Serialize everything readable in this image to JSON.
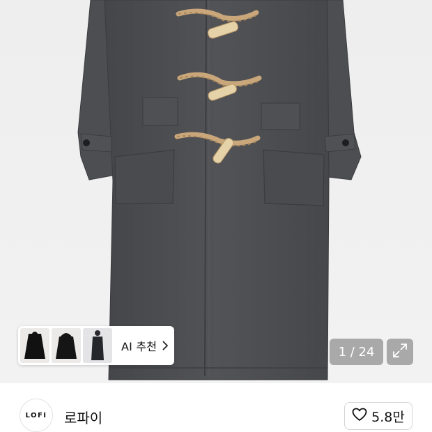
{
  "gallery": {
    "current_page": "1 / 24",
    "image_subject": "charcoal wool duffle coat"
  },
  "ai_recommend": {
    "label": "AI 추천",
    "thumbnails": [
      "black-coat-thumbnail",
      "black-hooded-coat-thumbnail",
      "model-long-coat-thumbnail"
    ]
  },
  "brand": {
    "logo_text": "LOFI",
    "name": "로파이"
  },
  "like": {
    "count": "5.8만"
  },
  "colors": {
    "coat": "#4b4c4e",
    "toggle_rope": "#c9a77a",
    "toggle_wood": "#e6d2a8",
    "overlay": "#6e6e6e"
  }
}
